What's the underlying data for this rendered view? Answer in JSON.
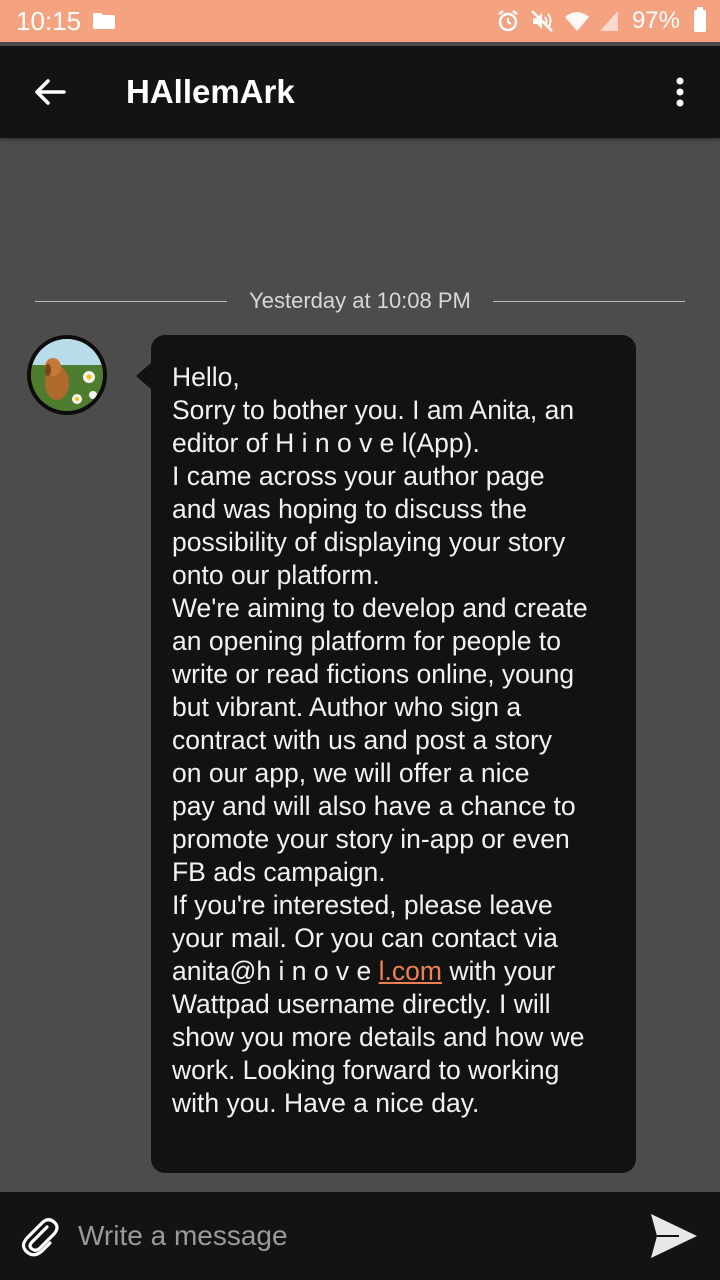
{
  "status_bar": {
    "time": "10:15",
    "battery": "97%"
  },
  "header": {
    "title": "HAllemArk"
  },
  "conversation": {
    "date_divider": "Yesterday at 10:08 PM",
    "message": {
      "text_before_link": "Hello,\nSorry to bother you. I am Anita, an\neditor of H i n o v e l(App).\nI came across your author page\nand was hoping to discuss the\npossibility of displaying your story\nonto our platform.\nWe're aiming to develop and create\nan opening platform for people to\nwrite or read fictions online, young\nbut vibrant. Author who sign a\ncontract with us and post a story\non our app, we will offer a nice\npay and will also have a chance to\npromote your story in-app or even\nFB ads campaign.\nIf you're interested, please leave\nyour mail. Or you can contact via\nanita@h i n o v e ",
      "link_text": "l.com",
      "text_after_link": " with your\nWattpad username directly. I will\nshow you more details and how we\nwork. Looking forward to working\nwith you. Have a nice day."
    }
  },
  "composer": {
    "placeholder": "Write a message"
  },
  "colors": {
    "status_bar": "#f4a27f",
    "app_bar": "#131313",
    "background": "#4c4c4c",
    "bubble": "#121212",
    "link": "#f08050"
  },
  "icons": {
    "back": "arrow-left-icon",
    "overflow": "more-vert-icon",
    "attach": "paperclip-icon",
    "send": "send-icon"
  }
}
